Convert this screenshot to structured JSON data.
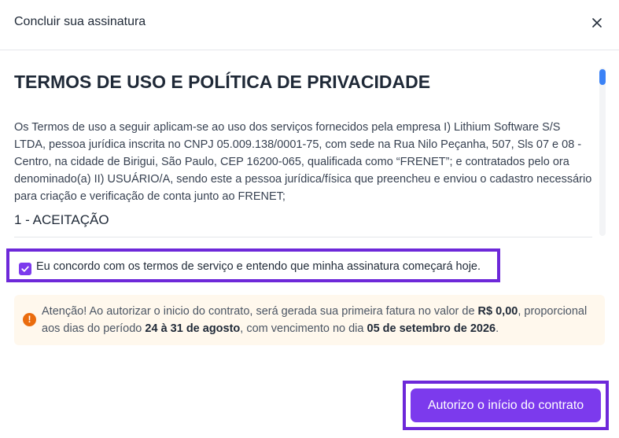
{
  "dialog": {
    "title": "Concluir sua assinatura",
    "close_icon": "close-icon"
  },
  "terms": {
    "heading": "TERMOS DE USO E POLÍTICA DE PRIVACIDADE",
    "paragraph": "Os Termos de uso a seguir aplicam-se ao uso dos serviços fornecidos pela empresa I) Lithium Software S/S LTDA, pessoa jurídica inscrita no CNPJ 05.009.138/0001-75, com sede na Rua Nilo Peçanha, 507, Sls 07 e 08 - Centro, na cidade de Birigui, São Paulo, CEP 16200-065, qualificada como “FRENET”; e contratados pelo ora denominado(a) II) USUÁRIO/A, sendo este a pessoa jurídica/física que preencheu e enviou o cadastro necessário para criação e verificação de conta junto ao FRENET;",
    "section_1": "1 - ACEITAÇÃO"
  },
  "consent": {
    "checked": true,
    "label": "Eu concordo com os termos de serviço e entendo que minha assinatura começará hoje."
  },
  "alert": {
    "icon": "warning-icon",
    "icon_glyph": "!",
    "part1": "Atenção! Ao autorizar o inicio do contrato, será gerada sua primeira fatura no valor de ",
    "amount": "R$ 0,00",
    "part2": ", proporcional aos dias do período ",
    "period": "24 à 31 de agosto",
    "part3": ", com vencimento no dia ",
    "due_date": "05 de setembro de 2026",
    "part4": "."
  },
  "actions": {
    "authorize_label": "Autorizo o início do contrato"
  },
  "colors": {
    "accent": "#7c3aed",
    "highlight_frame": "#6d28d9",
    "alert_background": "#fff8ed",
    "alert_icon": "#ea6c0e",
    "scroll_thumb": "#3b82f6"
  }
}
